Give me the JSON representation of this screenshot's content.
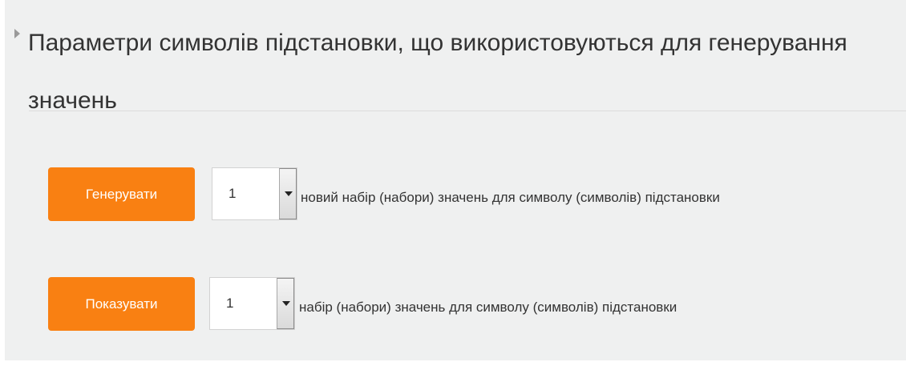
{
  "section": {
    "title": "Параметри символів підстановки, що використовуються для генерування значень"
  },
  "generate_row": {
    "button_label": "Генерувати",
    "select_value": "1",
    "label": "новий набір (набори) значень для символу (символів) підстановки"
  },
  "show_row": {
    "button_label": "Показувати",
    "select_value": "1",
    "label": "набір (набори) значень для символу (символів) підстановки"
  },
  "colors": {
    "accent": "#f98012",
    "panel_background": "#eff0f0",
    "text": "#333333"
  },
  "icons": {
    "section_toggle": "caret-right-icon",
    "dropdown": "chevron-down-icon"
  }
}
